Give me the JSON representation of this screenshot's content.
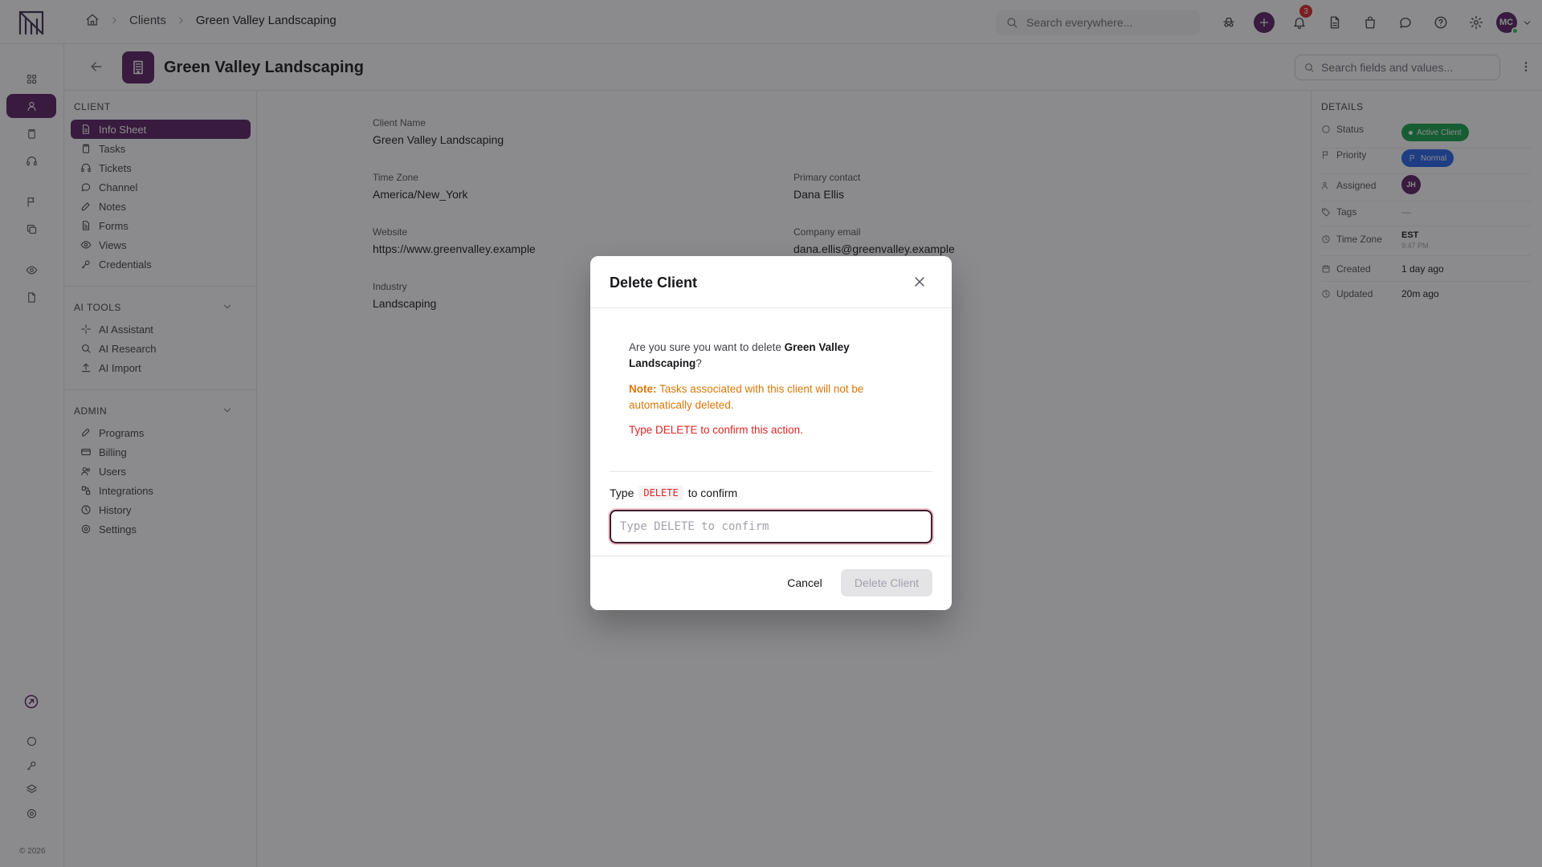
{
  "breadcrumb": {
    "section": "Clients",
    "current": "Green Valley Landscaping"
  },
  "global_search": {
    "placeholder": "Search everywhere..."
  },
  "notifications": {
    "count": "3"
  },
  "user": {
    "initials": "MC"
  },
  "header": {
    "title": "Green Valley Landscaping",
    "field_search_placeholder": "Search fields and values..."
  },
  "subnav": {
    "client_label": "CLIENT",
    "client_items": [
      "Info Sheet",
      "Tasks",
      "Tickets",
      "Channel",
      "Notes",
      "Forms",
      "Views",
      "Credentials"
    ],
    "ai_label": "AI TOOLS",
    "ai_items": [
      "AI Assistant",
      "AI Research",
      "AI Import"
    ],
    "admin_label": "ADMIN",
    "admin_items": [
      "Programs",
      "Billing",
      "Users",
      "Integrations",
      "History",
      "Settings"
    ]
  },
  "footer": {
    "copyright": "© 2026"
  },
  "fields": {
    "client_name": {
      "label": "Client Name",
      "value": "Green Valley Landscaping"
    },
    "time_zone": {
      "label": "Time Zone",
      "value": "America/New_York"
    },
    "primary_contact": {
      "label": "Primary contact",
      "value": "Dana Ellis"
    },
    "website": {
      "label": "Website",
      "value": "https://www.greenvalley.example"
    },
    "company_email": {
      "label": "Company email",
      "value": "dana.ellis@greenvalley.example"
    },
    "industry": {
      "label": "Industry",
      "value": "Landscaping"
    }
  },
  "details": {
    "title": "DETAILS",
    "status": {
      "label": "Status",
      "value": "Active Client",
      "color": "#16a34a"
    },
    "priority": {
      "label": "Priority",
      "value": "Normal",
      "color": "#2563eb"
    },
    "assigned": {
      "label": "Assigned",
      "value": "JH"
    },
    "tags": {
      "label": "Tags",
      "value": "—"
    },
    "time_zone": {
      "label": "Time Zone",
      "value": "EST",
      "sub": "9:47 PM"
    },
    "created": {
      "label": "Created",
      "value": "1 day ago"
    },
    "updated": {
      "label": "Updated",
      "value": "20m ago"
    }
  },
  "modal": {
    "title": "Delete Client",
    "question_prefix": "Are you sure you want to delete ",
    "client_name": "Green Valley Landscaping",
    "question_suffix": "?",
    "note_label": "Note:",
    "note_text": " Tasks associated with this client will not be automatically deleted.",
    "warning": "Type DELETE to confirm this action.",
    "confirm_prefix": "Type",
    "confirm_code": "DELETE",
    "confirm_suffix": "to confirm",
    "input_value": "",
    "input_placeholder": "Type DELETE to confirm",
    "cancel_label": "Cancel",
    "delete_label": "Delete Client"
  },
  "icons": {
    "rail_top": [
      "grid-icon",
      "user-icon",
      "clipboard-icon",
      "headset-icon",
      "flag-icon",
      "copy-icon",
      "eye-icon",
      "file-icon"
    ],
    "rail_bottom": [
      "rocket-icon",
      "chat-icon",
      "key-icon",
      "layers-icon",
      "gear-icon"
    ]
  },
  "colors": {
    "brand": "#5b1f63",
    "danger": "#dc2626",
    "note": "#d97706"
  }
}
